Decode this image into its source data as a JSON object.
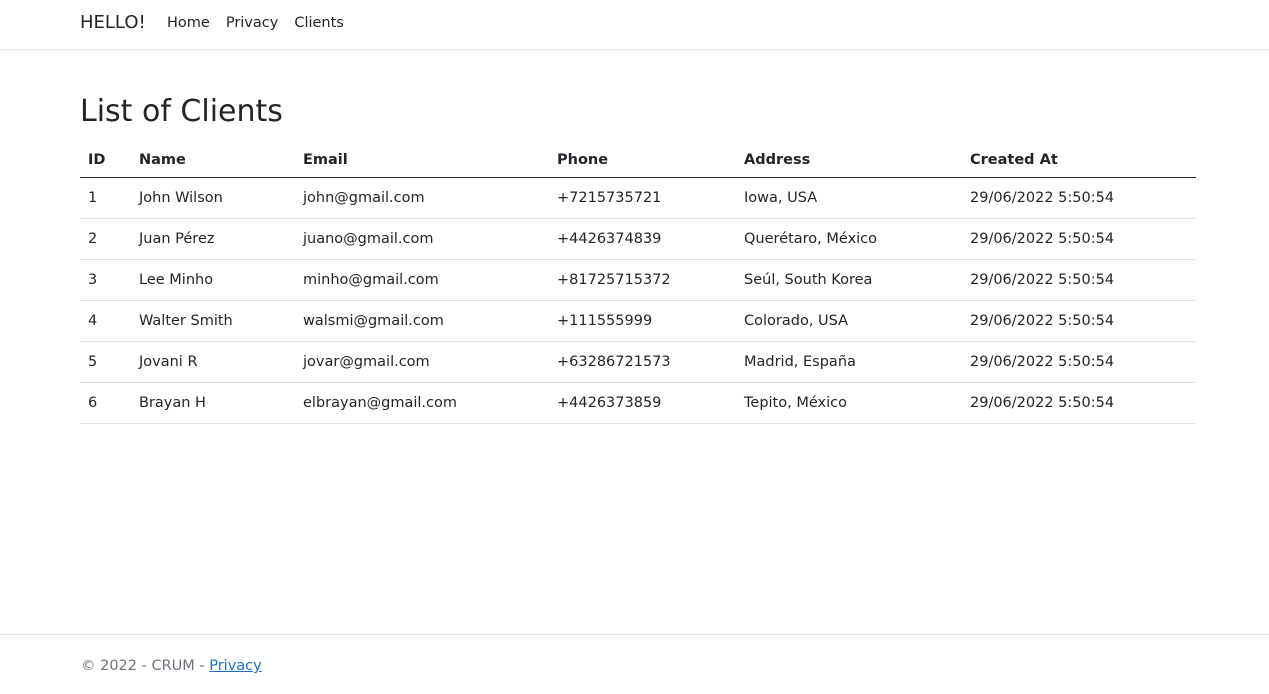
{
  "navbar": {
    "brand": "HELLO!",
    "links": [
      "Home",
      "Privacy",
      "Clients"
    ]
  },
  "page": {
    "title": "List of Clients"
  },
  "table": {
    "columns": [
      "ID",
      "Name",
      "Email",
      "Phone",
      "Address",
      "Created At"
    ],
    "rows": [
      [
        "1",
        "John Wilson",
        "john@gmail.com",
        "+7215735721",
        "Iowa, USA",
        "29/06/2022 5:50:54"
      ],
      [
        "2",
        "Juan Pérez",
        "juano@gmail.com",
        "+4426374839",
        "Querétaro, México",
        "29/06/2022 5:50:54"
      ],
      [
        "3",
        "Lee Minho",
        "minho@gmail.com",
        "+81725715372",
        "Seúl, South Korea",
        "29/06/2022 5:50:54"
      ],
      [
        "4",
        "Walter Smith",
        "walsmi@gmail.com",
        "+111555999",
        "Colorado, USA",
        "29/06/2022 5:50:54"
      ],
      [
        "5",
        "Jovani R",
        "jovar@gmail.com",
        "+63286721573",
        "Madrid, España",
        "29/06/2022 5:50:54"
      ],
      [
        "6",
        "Brayan H",
        "elbrayan@gmail.com",
        "+4426373859",
        "Tepito, México",
        "29/06/2022 5:50:54"
      ]
    ]
  },
  "footer": {
    "text": "© 2022 - CRUM - ",
    "link_label": "Privacy",
    "link_color": "#1b6ec2"
  }
}
